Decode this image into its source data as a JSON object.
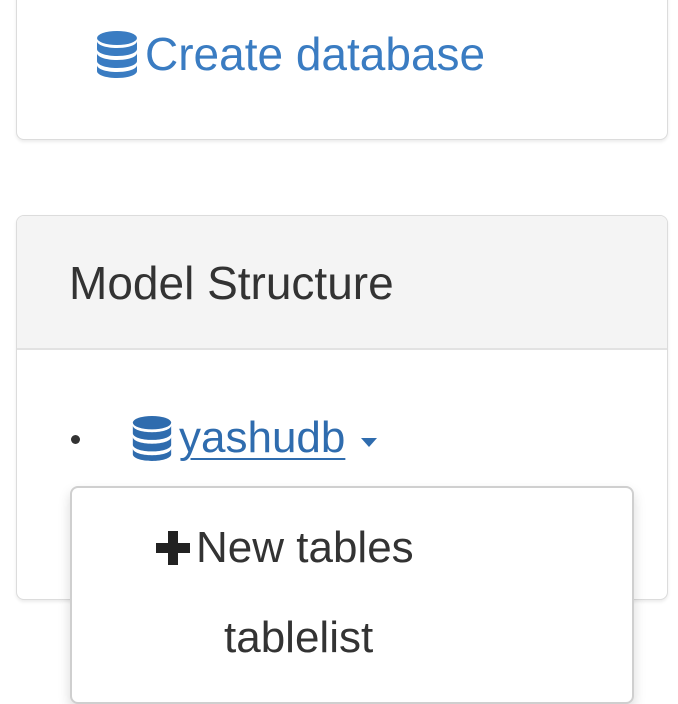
{
  "create_panel": {
    "link_label": "Create database",
    "icon": "database-icon"
  },
  "model_panel": {
    "title": "Model Structure",
    "items": [
      {
        "label": "yashudb",
        "icon": "database-icon",
        "has_dropdown": true
      },
      {
        "label": "",
        "icon": "database-icon"
      }
    ]
  },
  "dropdown": {
    "items": [
      {
        "label": "New tables",
        "icon": "plus-icon"
      },
      {
        "label": "tablelist"
      }
    ]
  },
  "colors": {
    "link": "#3a7cc2",
    "link_dark": "#2f6cae",
    "heading_bg": "#f4f4f4",
    "border": "#dcdcdc"
  }
}
